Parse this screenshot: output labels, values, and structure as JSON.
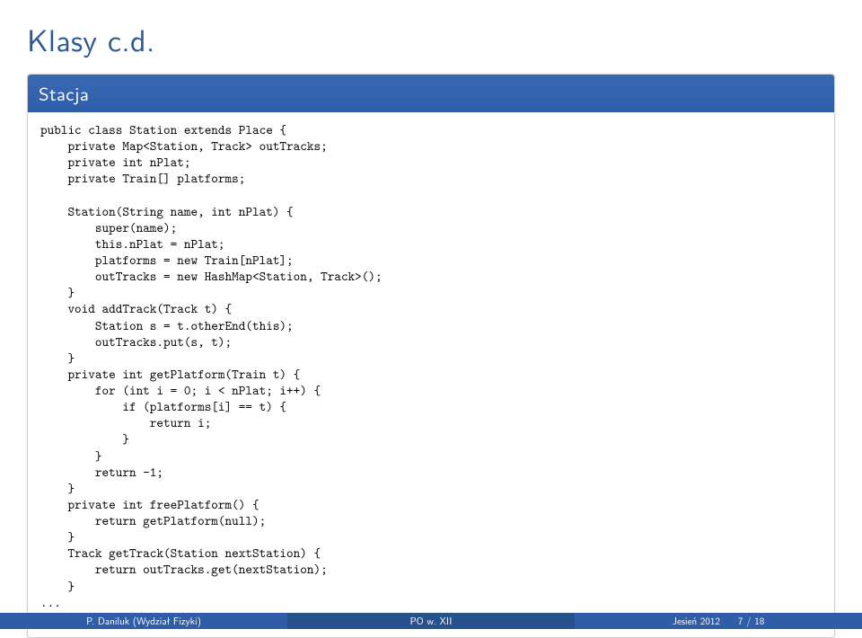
{
  "title": "Klasy c.d.",
  "block": {
    "heading": "Stacja",
    "code": "public class Station extends Place {\n    private Map<Station, Track> outTracks;\n    private int nPlat;\n    private Train[] platforms;\n\n    Station(String name, int nPlat) {\n        super(name);\n        this.nPlat = nPlat;\n        platforms = new Train[nPlat];\n        outTracks = new HashMap<Station, Track>();\n    }\n    void addTrack(Track t) {\n        Station s = t.otherEnd(this);\n        outTracks.put(s, t);\n    }\n    private int getPlatform(Train t) {\n        for (int i = 0; i < nPlat; i++) {\n            if (platforms[i] == t) {\n                return i;\n            }\n        }\n        return -1;\n    }\n    private int freePlatform() {\n        return getPlatform(null);\n    }\n    Track getTrack(Station nextStation) {\n        return outTracks.get(nextStation);\n    }\n...\n}"
  },
  "footer": {
    "author": "P. Daniluk (Wydział Fizyki)",
    "center": "PO w. XII",
    "term": "Jesień 2012",
    "page": "7 / 18"
  }
}
